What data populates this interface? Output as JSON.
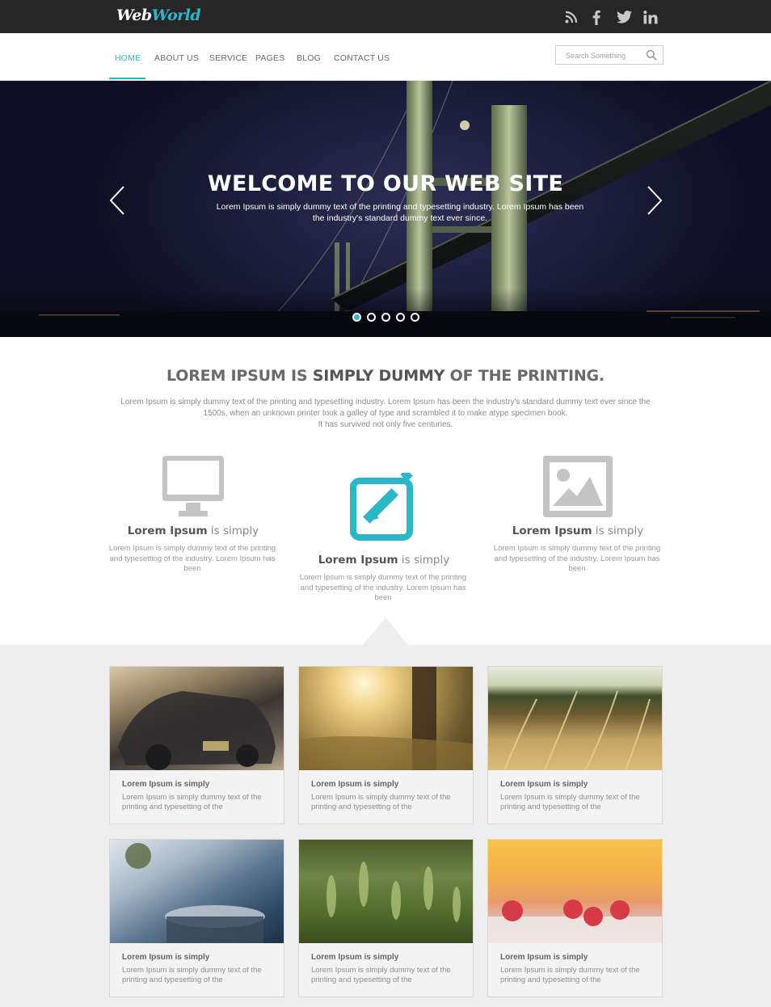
{
  "brand": {
    "part1": "Web",
    "part2": "World"
  },
  "social": [
    {
      "icon": "rss-icon"
    },
    {
      "icon": "facebook-icon"
    },
    {
      "icon": "twitter-icon"
    },
    {
      "icon": "linkedin-icon"
    }
  ],
  "nav": {
    "items": [
      {
        "label": "HOME",
        "active": true
      },
      {
        "label": "ABOUT US"
      },
      {
        "label": "SERVICE"
      },
      {
        "label": "PAGES"
      },
      {
        "label": "BLOG"
      },
      {
        "label": "CONTACT US"
      }
    ],
    "search_placeholder": "Search Something"
  },
  "hero": {
    "title": "WELCOME TO OUR WEB SITE",
    "text": "Lorem Ipsum is simply dummy text of the printing and typesetting industry. Lorem Ipsum has been the industry's standard dummy text ever since.",
    "slides": 5,
    "active_slide": 1
  },
  "intro": {
    "title_part1": "LOREM IPSUM IS ",
    "title_bold": "SIMPLY DUMMY",
    "title_part2": " OF THE PRINTING.",
    "text_line1": "Lorem Ipsum is simply dummy text of the printing and typesetting industry. Lorem Ipsum has been the industry's standard dummy text ever since the 1500s, when an unknown printer took a galley of type and scrambled it to make atype specimen book.",
    "text_line2": "It has survived not only five centuries."
  },
  "features": [
    {
      "icon": "monitor-icon",
      "title_bold": "Lorem Ipsum",
      "title_rest": " is simply",
      "text": "Lorem Ipsum is simply dummy text of the printing and typesetting of the industry. Lorem Ipsum has been"
    },
    {
      "icon": "edit-icon",
      "title_bold": "Lorem Ipsum",
      "title_rest": " is simply",
      "text": "Lorem Ipsum is simply dummy text of the printing and typesetting of the industry. Lorem Ipsum has been"
    },
    {
      "icon": "image-icon",
      "title_bold": "Lorem Ipsum",
      "title_rest": " is simply",
      "text": "Lorem Ipsum is simply dummy text of the printing and typesetting of the industry. Lorem Ipsum has been"
    }
  ],
  "accent_color": "#2ab8c8",
  "gallery": [
    {
      "image": "vintage-car-photo",
      "title": "Lorem Ipsum is simply",
      "text": "Lorem Ipsum is simply dummy text of the printing and typesetting of the"
    },
    {
      "image": "sunlit-field-photo",
      "title": "Lorem Ipsum is simply",
      "text": "Lorem Ipsum is simply dummy text of the printing and typesetting of the"
    },
    {
      "image": "wheat-field-photo",
      "title": "Lorem Ipsum is simply",
      "text": "Lorem Ipsum is simply dummy text of the printing and typesetting of the"
    },
    {
      "image": "steaming-cup-photo",
      "title": "Lorem Ipsum is simply",
      "text": "Lorem Ipsum is simply dummy text of the printing and typesetting of the"
    },
    {
      "image": "green-wheat-photo",
      "title": "Lorem Ipsum is simply",
      "text": "Lorem Ipsum is simply dummy text of the printing and typesetting of the"
    },
    {
      "image": "raspberries-photo",
      "title": "Lorem Ipsum is simply",
      "text": "Lorem Ipsum is simply dummy text of the printing and typesetting of the"
    }
  ]
}
